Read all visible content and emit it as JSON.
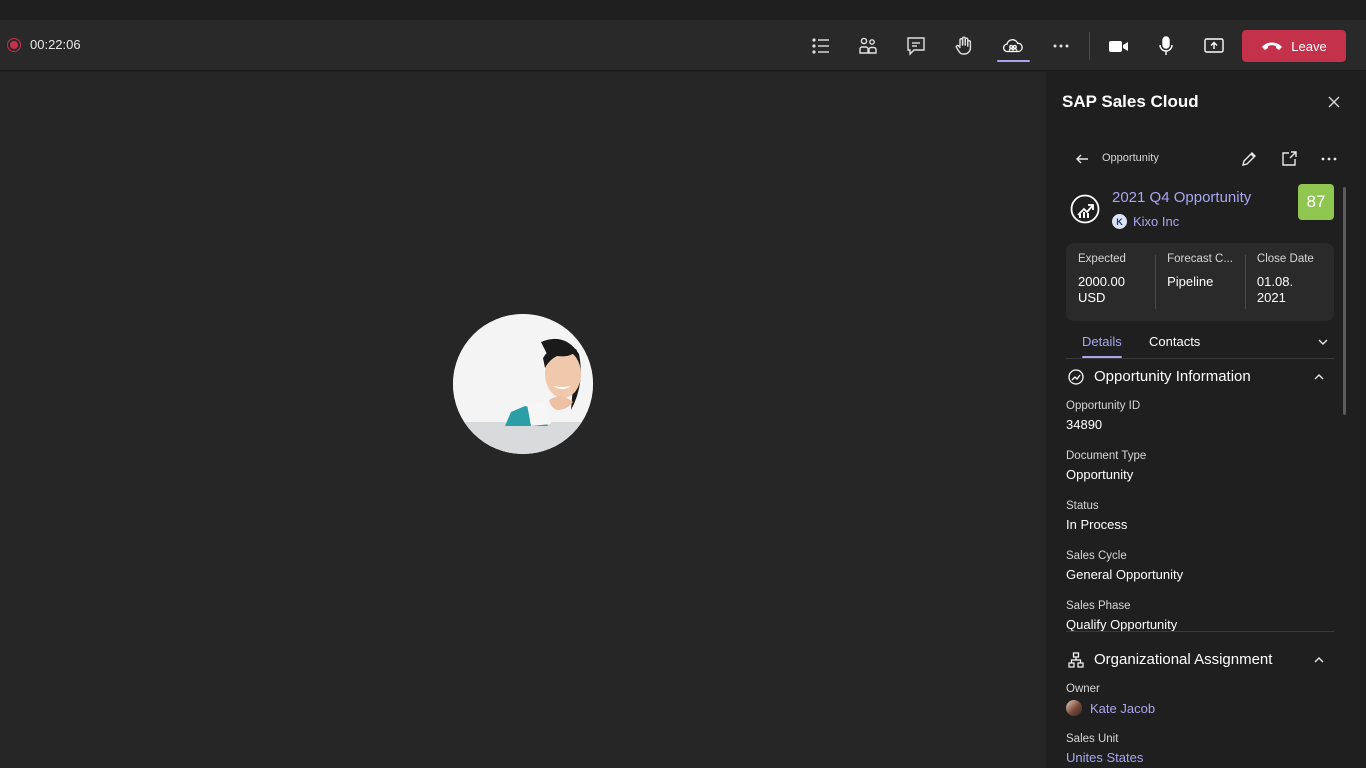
{
  "call": {
    "timer": "00:22:06",
    "leave_label": "Leave",
    "toolbar_icons": [
      "list-icon",
      "people-icon",
      "chat-icon",
      "raise-hand-icon",
      "apps-cloud-icon",
      "more-icon",
      "camera-icon",
      "mic-icon",
      "share-screen-icon"
    ]
  },
  "panel": {
    "title": "SAP Sales Cloud",
    "nav_label": "Opportunity",
    "opportunity": {
      "title": "2021 Q4 Opportunity",
      "company": "Kixo Inc",
      "company_initial": "K",
      "score": "87"
    },
    "kpis": [
      {
        "label": "Expected",
        "value": "2000.00 USD"
      },
      {
        "label": "Forecast C...",
        "value": "Pipeline"
      },
      {
        "label": "Close Date",
        "value": "01.08. 2021"
      }
    ],
    "tabs": [
      "Details",
      "Contacts"
    ],
    "sections": {
      "opportunity_info": {
        "title": "Opportunity Information",
        "fields": [
          {
            "label": "Opportunity ID",
            "value": "34890"
          },
          {
            "label": "Document Type",
            "value": "Opportunity"
          },
          {
            "label": "Status",
            "value": "In Process"
          },
          {
            "label": "Sales Cycle",
            "value": "General Opportunity"
          },
          {
            "label": "Sales Phase",
            "value": "Qualify Opportunity"
          }
        ]
      },
      "org_assignment": {
        "title": "Organizational Assignment",
        "owner_label": "Owner",
        "owner_value": "Kate Jacob",
        "sales_unit_label": "Sales Unit",
        "sales_unit_value": "Unites States"
      }
    }
  },
  "colors": {
    "accent": "#a9a6f0",
    "leave": "#c4314b",
    "score": "#8fc64f",
    "background": "#1f1f1f"
  }
}
